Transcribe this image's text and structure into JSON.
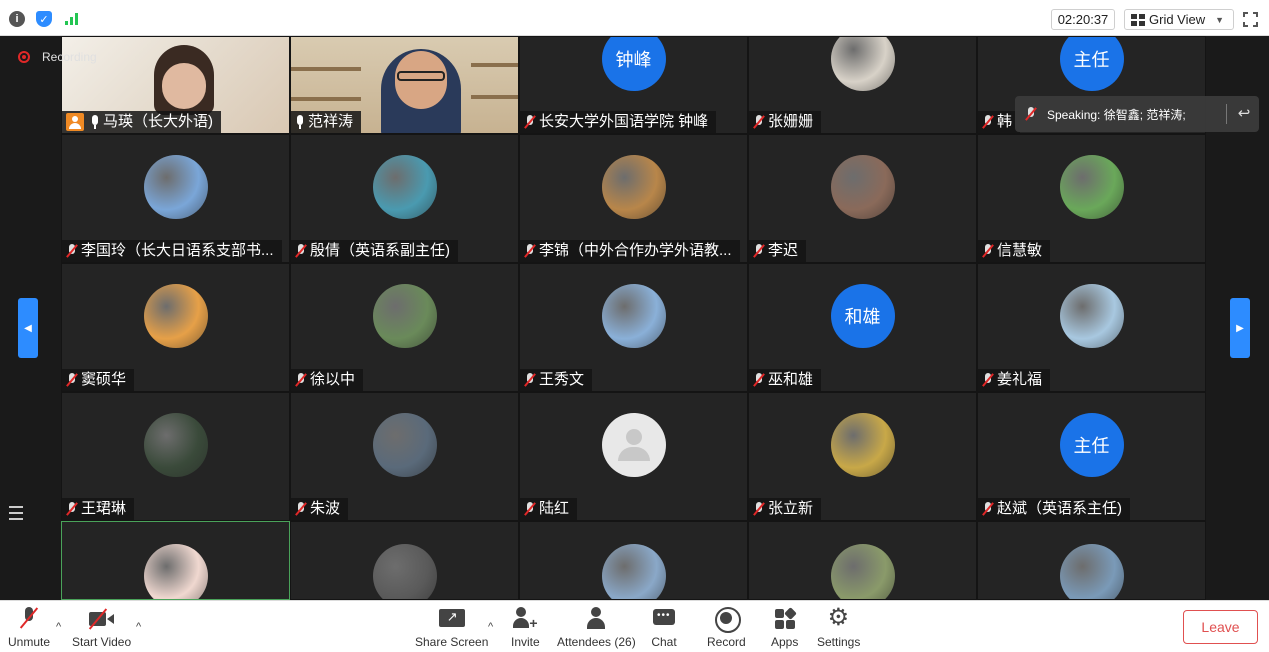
{
  "topbar": {
    "timer": "02:20:37",
    "view_label": "Grid View"
  },
  "recording": {
    "label": "Recording"
  },
  "speaking": {
    "text": "Speaking: 徐智鑫; 范祥涛;"
  },
  "participants": [
    {
      "name": "马瑛（长大外语)",
      "kind": "video",
      "mic": "on",
      "host": true
    },
    {
      "name": "范祥涛",
      "kind": "video",
      "mic": "on",
      "host": false
    },
    {
      "name": "长安大学外国语学院 钟峰",
      "kind": "text",
      "avatar_text": "钟峰",
      "mic": "muted"
    },
    {
      "name": "张姗姗",
      "kind": "photo",
      "avatar_color": "#d8d2c8",
      "mic": "muted"
    },
    {
      "name": "韩",
      "kind": "text",
      "avatar_text": "主任",
      "mic": "muted"
    },
    {
      "name": "李国玲（长大日语系支部书...",
      "kind": "photo",
      "avatar_color": "#7aa6d8",
      "mic": "muted"
    },
    {
      "name": "殷倩（英语系副主任)",
      "kind": "photo",
      "avatar_color": "#4a9ab0",
      "mic": "muted"
    },
    {
      "name": "李锦（中外合作办学外语教...",
      "kind": "photo",
      "avatar_color": "#b8864a",
      "mic": "muted"
    },
    {
      "name": "李迟",
      "kind": "photo",
      "avatar_color": "#8a6a5a",
      "mic": "muted"
    },
    {
      "name": "信慧敏",
      "kind": "photo",
      "avatar_color": "#6aa85a",
      "mic": "muted"
    },
    {
      "name": "窦硕华",
      "kind": "photo",
      "avatar_color": "#e6a048",
      "mic": "muted"
    },
    {
      "name": "徐以中",
      "kind": "photo",
      "avatar_color": "#6a8a5a",
      "mic": "muted"
    },
    {
      "name": "王秀文",
      "kind": "photo",
      "avatar_color": "#8ab0d8",
      "mic": "muted"
    },
    {
      "name": "巫和雄",
      "kind": "text",
      "avatar_text": "和雄",
      "mic": "muted"
    },
    {
      "name": "姜礼福",
      "kind": "photo",
      "avatar_color": "#a8c8e0",
      "mic": "muted"
    },
    {
      "name": "王珺琳",
      "kind": "photo",
      "avatar_color": "#3a4a3a",
      "mic": "muted"
    },
    {
      "name": "朱波",
      "kind": "photo",
      "avatar_color": "#5a6a7a",
      "mic": "muted"
    },
    {
      "name": "陆红",
      "kind": "default",
      "avatar_color": "#e8e8e8",
      "mic": "muted"
    },
    {
      "name": "张立新",
      "kind": "photo",
      "avatar_color": "#c8a848",
      "mic": "muted"
    },
    {
      "name": "赵斌（英语系主任)",
      "kind": "text",
      "avatar_text": "主任",
      "mic": "muted"
    },
    {
      "name": "",
      "kind": "photo",
      "avatar_color": "#f0d8d0",
      "mic": "none"
    },
    {
      "name": "",
      "kind": "photo",
      "avatar_color": "#5a5a5a",
      "mic": "none"
    },
    {
      "name": "",
      "kind": "photo",
      "avatar_color": "#8aa8c8",
      "mic": "none"
    },
    {
      "name": "",
      "kind": "photo",
      "avatar_color": "#8a9a6a",
      "mic": "none"
    },
    {
      "name": "",
      "kind": "photo",
      "avatar_color": "#7a9ab8",
      "mic": "none"
    }
  ],
  "toolbar": {
    "unmute": "Unmute",
    "start_video": "Start Video",
    "share_screen": "Share Screen",
    "invite": "Invite",
    "attendees": "Attendees (26)",
    "chat": "Chat",
    "record": "Record",
    "apps": "Apps",
    "settings": "Settings",
    "leave": "Leave"
  },
  "colors": {
    "accent": "#2d8cff",
    "avatar_blue": "#1a73e8",
    "host_orange": "#f08a24",
    "muted_red": "#e02828",
    "leave_red": "#e05050"
  }
}
